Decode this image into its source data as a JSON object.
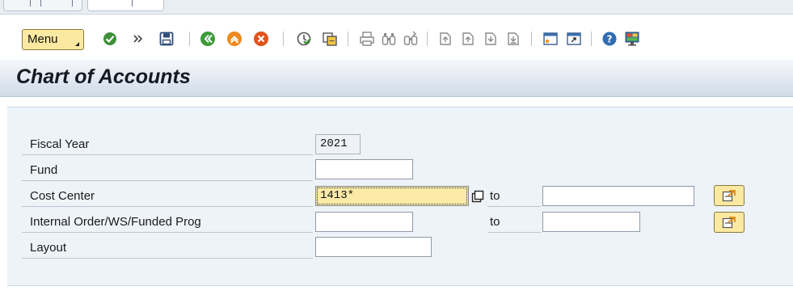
{
  "toolbar": {
    "menu_label": "Menu",
    "icons": [
      "check-icon",
      "forward-icon",
      "save-icon",
      "back-icon",
      "exit-icon",
      "cancel-icon",
      "execute-icon",
      "get-variant-icon",
      "print-icon",
      "find-icon",
      "find-next-icon",
      "first-page-icon",
      "previous-page-icon",
      "next-page-icon",
      "last-page-icon",
      "create-session-icon",
      "shortcut-icon",
      "help-icon",
      "settings-icon"
    ]
  },
  "page": {
    "title": "Chart of Accounts"
  },
  "form": {
    "fiscal_year": {
      "label": "Fiscal Year",
      "value": "2021"
    },
    "fund": {
      "label": "Fund",
      "value": ""
    },
    "cost_center": {
      "label": "Cost Center",
      "value": "1413*",
      "to_label": "to",
      "to_value": ""
    },
    "internal_order": {
      "label": "Internal Order/WS/Funded Prog",
      "value": "",
      "to_label": "to",
      "to_value": ""
    },
    "layout": {
      "label": "Layout",
      "value": ""
    }
  },
  "colors": {
    "accent_yellow": "#fbe9a1",
    "panel_bg": "#eef3f8",
    "title_gradient_end": "#cfdbe6"
  }
}
